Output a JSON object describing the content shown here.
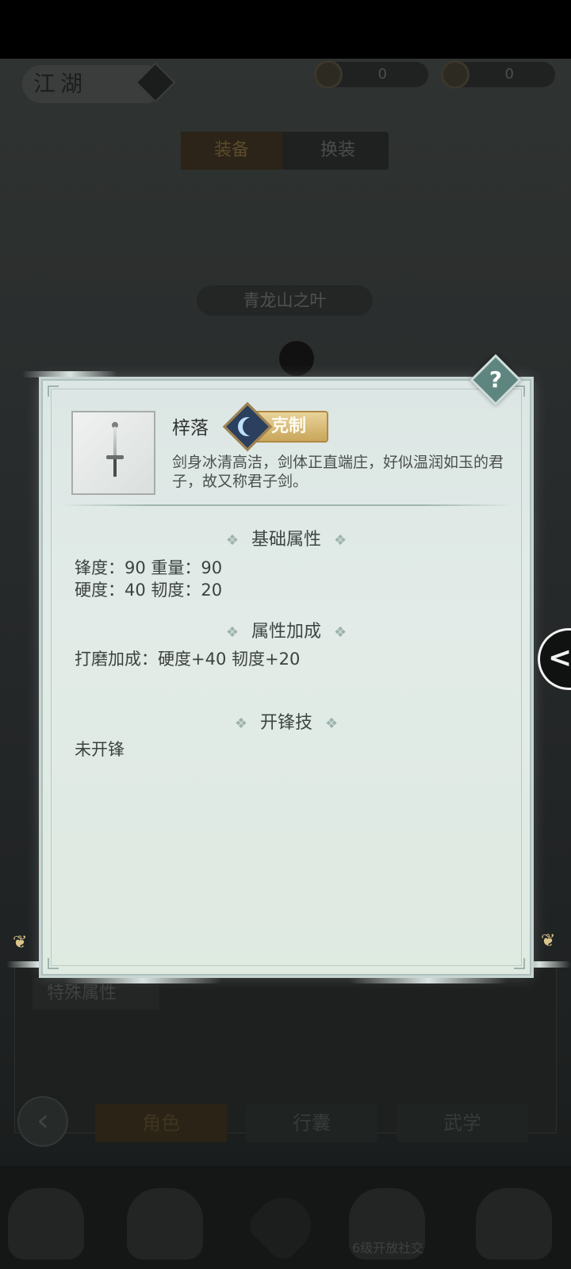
{
  "header": {
    "title": "江湖",
    "currencies": [
      {
        "icon": "coin-icon",
        "value": "0"
      },
      {
        "icon": "ingot-icon",
        "value": "0"
      }
    ]
  },
  "equip_tabs": [
    "装备",
    "换装"
  ],
  "character": {
    "name": "青龙山之叶"
  },
  "special": {
    "label": "特殊属性"
  },
  "bottom_nav": [
    "角色",
    "行囊",
    "武学"
  ],
  "dock": {
    "social_label": "6级开放社交"
  },
  "popup": {
    "item_name": "梓落",
    "tag": "克制",
    "description": "剑身冰清高洁，剑体正直端庄，好似温润如玉的君子，故又称君子剑。",
    "sections": {
      "base": {
        "title": "基础属性",
        "line1": "锋度：90  重量：90",
        "line2": "硬度：40  韧度：20"
      },
      "bonus": {
        "title": "属性加成",
        "line": "打磨加成：硬度+40  韧度+20"
      },
      "skill": {
        "title": "开锋技",
        "line": "未开锋"
      }
    },
    "help_glyph": "?"
  },
  "side_tab_glyph": "<",
  "ornament": "❖",
  "colors": {
    "popup_bg": "#dfe8e5",
    "tag_gold": "#c9a65a",
    "help_teal": "#5f8580"
  }
}
